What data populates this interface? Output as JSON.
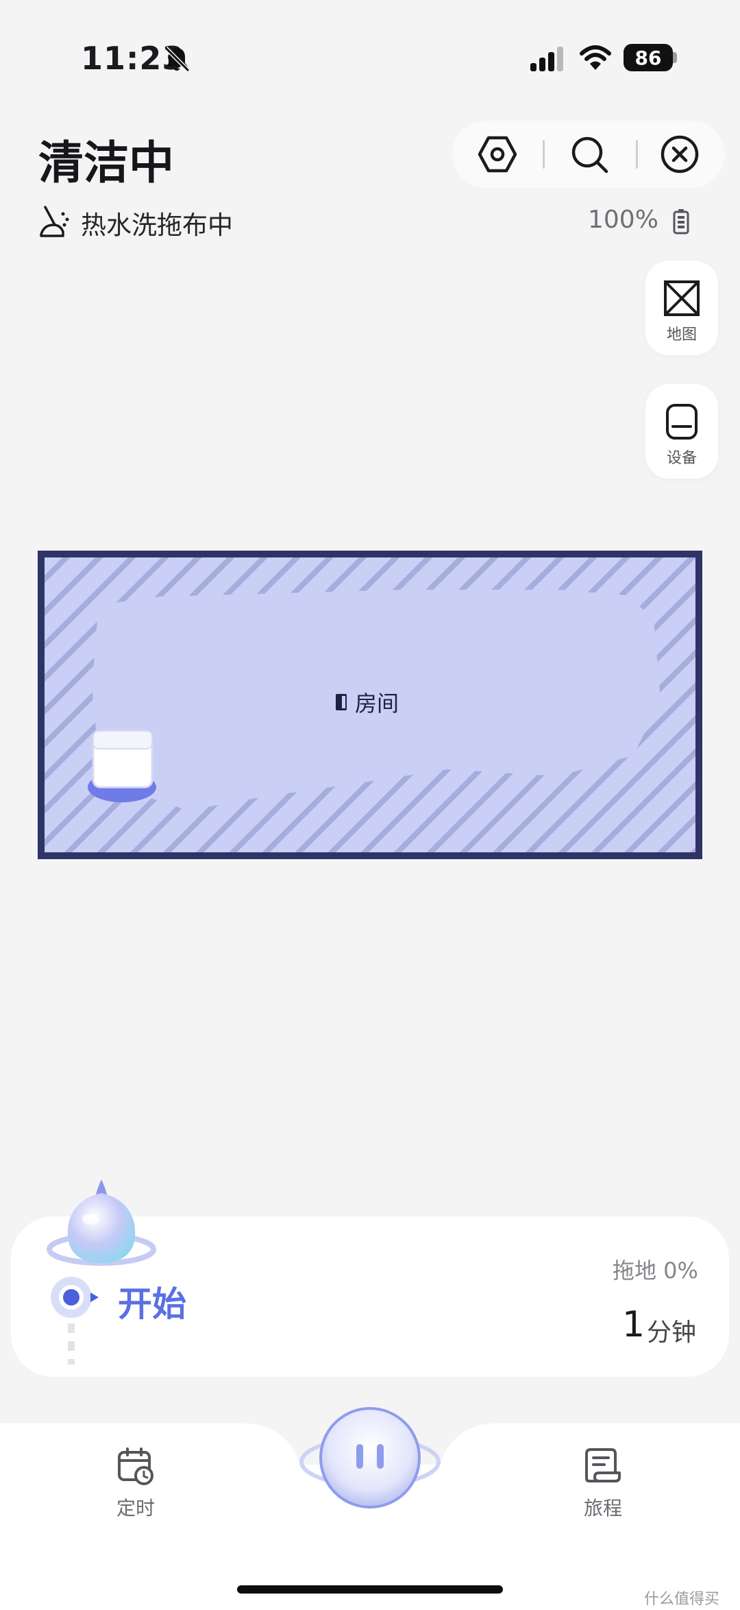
{
  "status_bar": {
    "time": "11:23",
    "battery_level": "86"
  },
  "header": {
    "title": "清洁中",
    "actions": [
      "settings-icon",
      "search-icon",
      "close-icon"
    ]
  },
  "sub_status": {
    "text": "热水洗拖布中",
    "battery_percent": "100%"
  },
  "side_buttons": [
    {
      "label": "地图",
      "icon": "map-icon"
    },
    {
      "label": "设备",
      "icon": "device-icon"
    }
  ],
  "map": {
    "room_name": "房间",
    "colors": {
      "room_fill": "#c9cff5",
      "border": "#2f3466",
      "hatch": "#9fa6d6"
    }
  },
  "progress": {
    "step_label": "开始",
    "mode_text": "拖地 0%",
    "time_value": "1",
    "time_unit": "分钟",
    "accent": "#5a70e3"
  },
  "bottom_nav": {
    "schedule_label": "定时",
    "trip_label": "旅程",
    "center_action": "pause-icon"
  },
  "watermark": "什么值得买"
}
